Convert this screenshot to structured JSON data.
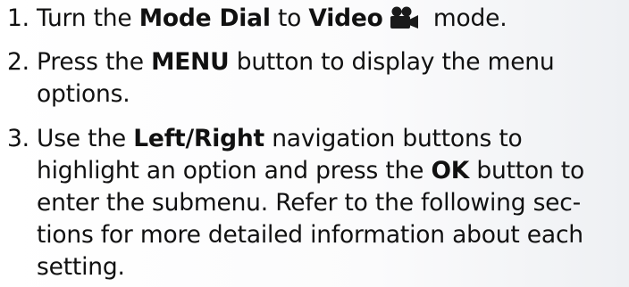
{
  "steps": [
    {
      "number": "1.",
      "pre": "Turn the ",
      "b1": "Mode Dial",
      "mid": " to ",
      "b2": "Video",
      "icon": "video-camera-icon",
      "post": " mode."
    },
    {
      "number": "2.",
      "pre": "Press the ",
      "b1": "MENU",
      "post_line1": " button to display the menu",
      "line2": "options."
    },
    {
      "number": "3.",
      "pre": "Use the ",
      "b1": "Left/Right",
      "post_line1": " navigation buttons to",
      "line2_pre": "highlight an option and press the ",
      "b2": "OK",
      "line2_post": " button to",
      "line3": "enter the submenu. Refer to the following sec-",
      "line4": "tions for more detailed information about each",
      "line5": "setting."
    }
  ],
  "colors": {
    "text": "#111111",
    "icon": "#1a1a1a"
  }
}
